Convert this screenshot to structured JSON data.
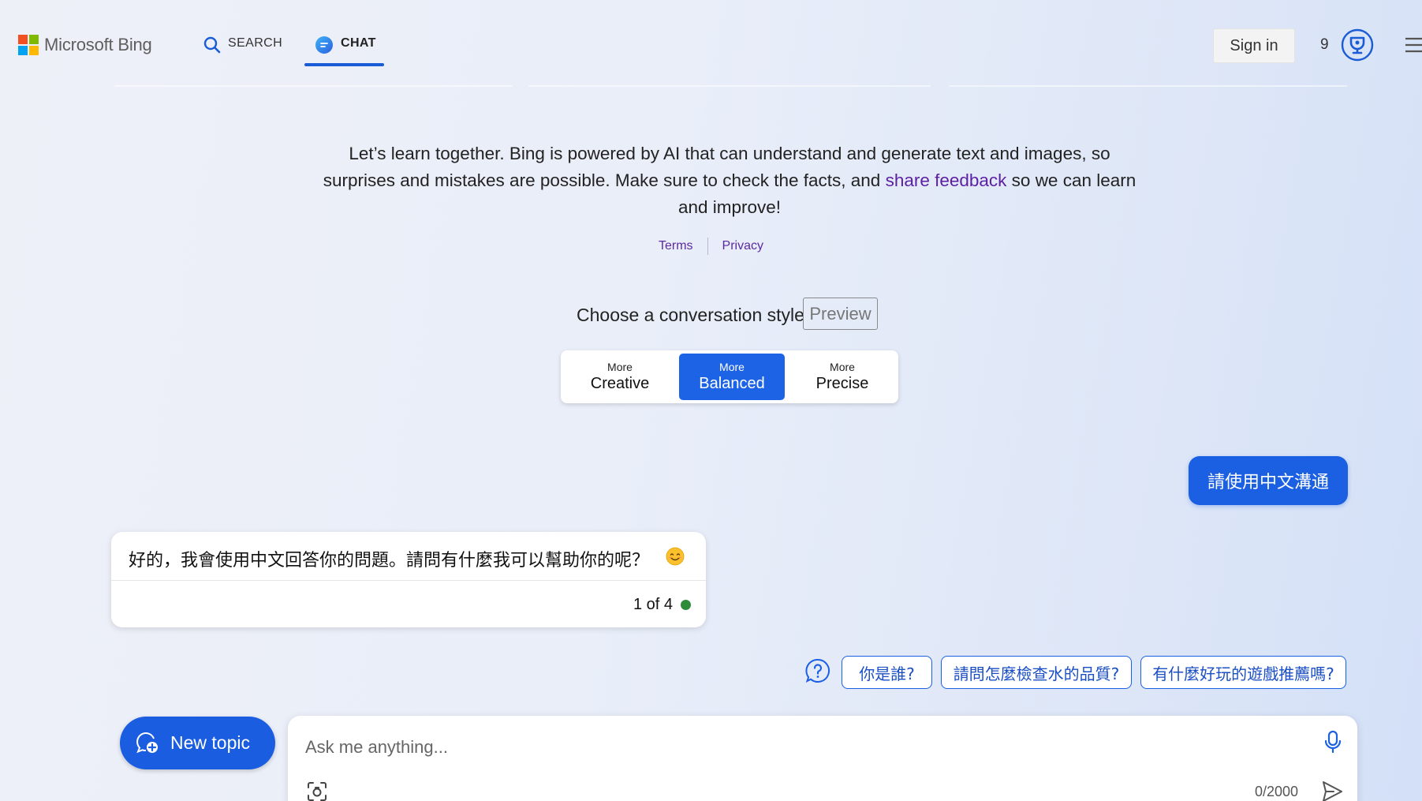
{
  "header": {
    "brand": "Microsoft Bing",
    "brand_colors": [
      "#f25022",
      "#7fba00",
      "#00a4ef",
      "#ffb900"
    ],
    "tabs": [
      {
        "label": "SEARCH",
        "icon": "search-icon"
      },
      {
        "label": "CHAT",
        "icon": "chat-bubble-icon",
        "active": true
      }
    ],
    "sign_in": "Sign in",
    "rewards_count": "9",
    "rewards_icon": "trophy-icon",
    "menu_icon": "hamburger-menu-icon"
  },
  "intro": {
    "text_before": "Let’s learn together. Bing is powered by AI that can understand and generate text and images, so surprises and mistakes are possible. Make sure to check the facts, and ",
    "link": "share feedback",
    "text_after": " so we can learn and improve!",
    "terms": "Terms",
    "privacy": "Privacy"
  },
  "style_picker": {
    "title": "Choose a conversation style",
    "badge": "Preview",
    "options": [
      {
        "small": "More",
        "label": "Creative"
      },
      {
        "small": "More",
        "label": "Balanced",
        "active": true
      },
      {
        "small": "More",
        "label": "Precise"
      }
    ],
    "accent": "#1d63e5"
  },
  "conversation": {
    "user_message": "請使用中文溝通",
    "bot_message": "好的，我會使用中文回答你的問題。請問有什麼我可以幫助你的呢？",
    "bot_emoji": "smiling-face-emoji",
    "bot_counter": "1 of 4",
    "status_color": "#2e8b3a"
  },
  "suggestions": {
    "help_icon": "question-bubble-icon",
    "chips": [
      "你是誰?",
      "請問怎麼檢查水的品質?",
      "有什麼好玩的遊戲推薦嗎?"
    ]
  },
  "composer": {
    "new_topic": "New topic",
    "placeholder": "Ask me anything...",
    "char_count": "0/2000",
    "mic_icon": "microphone-icon",
    "image_icon": "image-search-icon",
    "send_icon": "send-icon"
  }
}
